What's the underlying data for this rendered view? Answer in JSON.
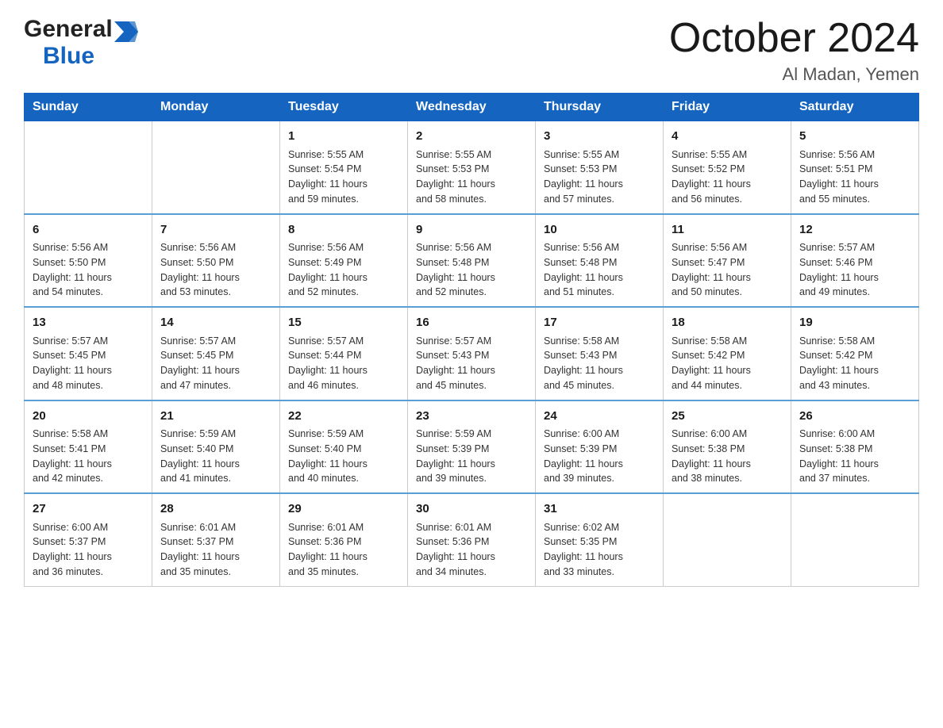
{
  "header": {
    "title": "October 2024",
    "location": "Al Madan, Yemen",
    "logo_general": "General",
    "logo_blue": "Blue"
  },
  "weekdays": [
    "Sunday",
    "Monday",
    "Tuesday",
    "Wednesday",
    "Thursday",
    "Friday",
    "Saturday"
  ],
  "weeks": [
    [
      {
        "day": "",
        "info": ""
      },
      {
        "day": "",
        "info": ""
      },
      {
        "day": "1",
        "info": "Sunrise: 5:55 AM\nSunset: 5:54 PM\nDaylight: 11 hours\nand 59 minutes."
      },
      {
        "day": "2",
        "info": "Sunrise: 5:55 AM\nSunset: 5:53 PM\nDaylight: 11 hours\nand 58 minutes."
      },
      {
        "day": "3",
        "info": "Sunrise: 5:55 AM\nSunset: 5:53 PM\nDaylight: 11 hours\nand 57 minutes."
      },
      {
        "day": "4",
        "info": "Sunrise: 5:55 AM\nSunset: 5:52 PM\nDaylight: 11 hours\nand 56 minutes."
      },
      {
        "day": "5",
        "info": "Sunrise: 5:56 AM\nSunset: 5:51 PM\nDaylight: 11 hours\nand 55 minutes."
      }
    ],
    [
      {
        "day": "6",
        "info": "Sunrise: 5:56 AM\nSunset: 5:50 PM\nDaylight: 11 hours\nand 54 minutes."
      },
      {
        "day": "7",
        "info": "Sunrise: 5:56 AM\nSunset: 5:50 PM\nDaylight: 11 hours\nand 53 minutes."
      },
      {
        "day": "8",
        "info": "Sunrise: 5:56 AM\nSunset: 5:49 PM\nDaylight: 11 hours\nand 52 minutes."
      },
      {
        "day": "9",
        "info": "Sunrise: 5:56 AM\nSunset: 5:48 PM\nDaylight: 11 hours\nand 52 minutes."
      },
      {
        "day": "10",
        "info": "Sunrise: 5:56 AM\nSunset: 5:48 PM\nDaylight: 11 hours\nand 51 minutes."
      },
      {
        "day": "11",
        "info": "Sunrise: 5:56 AM\nSunset: 5:47 PM\nDaylight: 11 hours\nand 50 minutes."
      },
      {
        "day": "12",
        "info": "Sunrise: 5:57 AM\nSunset: 5:46 PM\nDaylight: 11 hours\nand 49 minutes."
      }
    ],
    [
      {
        "day": "13",
        "info": "Sunrise: 5:57 AM\nSunset: 5:45 PM\nDaylight: 11 hours\nand 48 minutes."
      },
      {
        "day": "14",
        "info": "Sunrise: 5:57 AM\nSunset: 5:45 PM\nDaylight: 11 hours\nand 47 minutes."
      },
      {
        "day": "15",
        "info": "Sunrise: 5:57 AM\nSunset: 5:44 PM\nDaylight: 11 hours\nand 46 minutes."
      },
      {
        "day": "16",
        "info": "Sunrise: 5:57 AM\nSunset: 5:43 PM\nDaylight: 11 hours\nand 45 minutes."
      },
      {
        "day": "17",
        "info": "Sunrise: 5:58 AM\nSunset: 5:43 PM\nDaylight: 11 hours\nand 45 minutes."
      },
      {
        "day": "18",
        "info": "Sunrise: 5:58 AM\nSunset: 5:42 PM\nDaylight: 11 hours\nand 44 minutes."
      },
      {
        "day": "19",
        "info": "Sunrise: 5:58 AM\nSunset: 5:42 PM\nDaylight: 11 hours\nand 43 minutes."
      }
    ],
    [
      {
        "day": "20",
        "info": "Sunrise: 5:58 AM\nSunset: 5:41 PM\nDaylight: 11 hours\nand 42 minutes."
      },
      {
        "day": "21",
        "info": "Sunrise: 5:59 AM\nSunset: 5:40 PM\nDaylight: 11 hours\nand 41 minutes."
      },
      {
        "day": "22",
        "info": "Sunrise: 5:59 AM\nSunset: 5:40 PM\nDaylight: 11 hours\nand 40 minutes."
      },
      {
        "day": "23",
        "info": "Sunrise: 5:59 AM\nSunset: 5:39 PM\nDaylight: 11 hours\nand 39 minutes."
      },
      {
        "day": "24",
        "info": "Sunrise: 6:00 AM\nSunset: 5:39 PM\nDaylight: 11 hours\nand 39 minutes."
      },
      {
        "day": "25",
        "info": "Sunrise: 6:00 AM\nSunset: 5:38 PM\nDaylight: 11 hours\nand 38 minutes."
      },
      {
        "day": "26",
        "info": "Sunrise: 6:00 AM\nSunset: 5:38 PM\nDaylight: 11 hours\nand 37 minutes."
      }
    ],
    [
      {
        "day": "27",
        "info": "Sunrise: 6:00 AM\nSunset: 5:37 PM\nDaylight: 11 hours\nand 36 minutes."
      },
      {
        "day": "28",
        "info": "Sunrise: 6:01 AM\nSunset: 5:37 PM\nDaylight: 11 hours\nand 35 minutes."
      },
      {
        "day": "29",
        "info": "Sunrise: 6:01 AM\nSunset: 5:36 PM\nDaylight: 11 hours\nand 35 minutes."
      },
      {
        "day": "30",
        "info": "Sunrise: 6:01 AM\nSunset: 5:36 PM\nDaylight: 11 hours\nand 34 minutes."
      },
      {
        "day": "31",
        "info": "Sunrise: 6:02 AM\nSunset: 5:35 PM\nDaylight: 11 hours\nand 33 minutes."
      },
      {
        "day": "",
        "info": ""
      },
      {
        "day": "",
        "info": ""
      }
    ]
  ]
}
